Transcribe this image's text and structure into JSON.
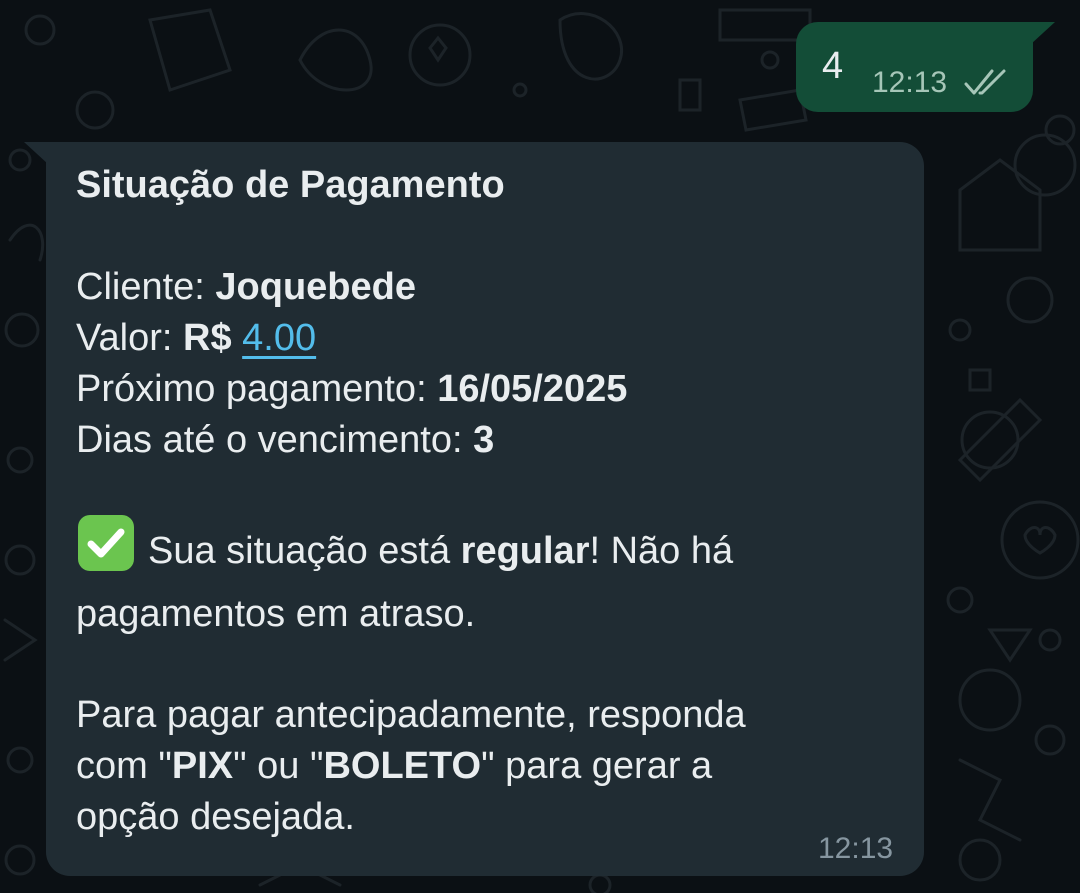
{
  "outgoing": {
    "text": "4",
    "time": "12:13",
    "status_icon": "double-check-icon"
  },
  "incoming": {
    "title": "Situação de Pagamento",
    "client_label": "Cliente:",
    "client_name": "Joquebede",
    "amount_label": "Valor:",
    "currency": "R$",
    "amount": "4.00",
    "next_payment_label": "Próximo pagamento:",
    "next_payment_date": "16/05/2025",
    "days_label": "Dias até o vencimento:",
    "days_value": "3",
    "status_icon": "check-mark-button-icon",
    "status_prefix": "Sua situação está",
    "status_word": "regular",
    "status_suffix": "! Não há",
    "status_line2": "pagamentos em atraso.",
    "cta_line1": "Para pagar antecipadamente, responda",
    "cta_com": "com \"",
    "cta_pix": "PIX",
    "cta_ou": "\" ou \"",
    "cta_boleto": "BOLETO",
    "cta_end": "\" para gerar a",
    "cta_line3": "opção desejada.",
    "time": "12:13"
  },
  "colors": {
    "background": "#0b1014",
    "outgoing_bubble": "#134d37",
    "incoming_bubble": "#202c33",
    "link": "#53bdeb",
    "check_green": "#6bc54f"
  }
}
